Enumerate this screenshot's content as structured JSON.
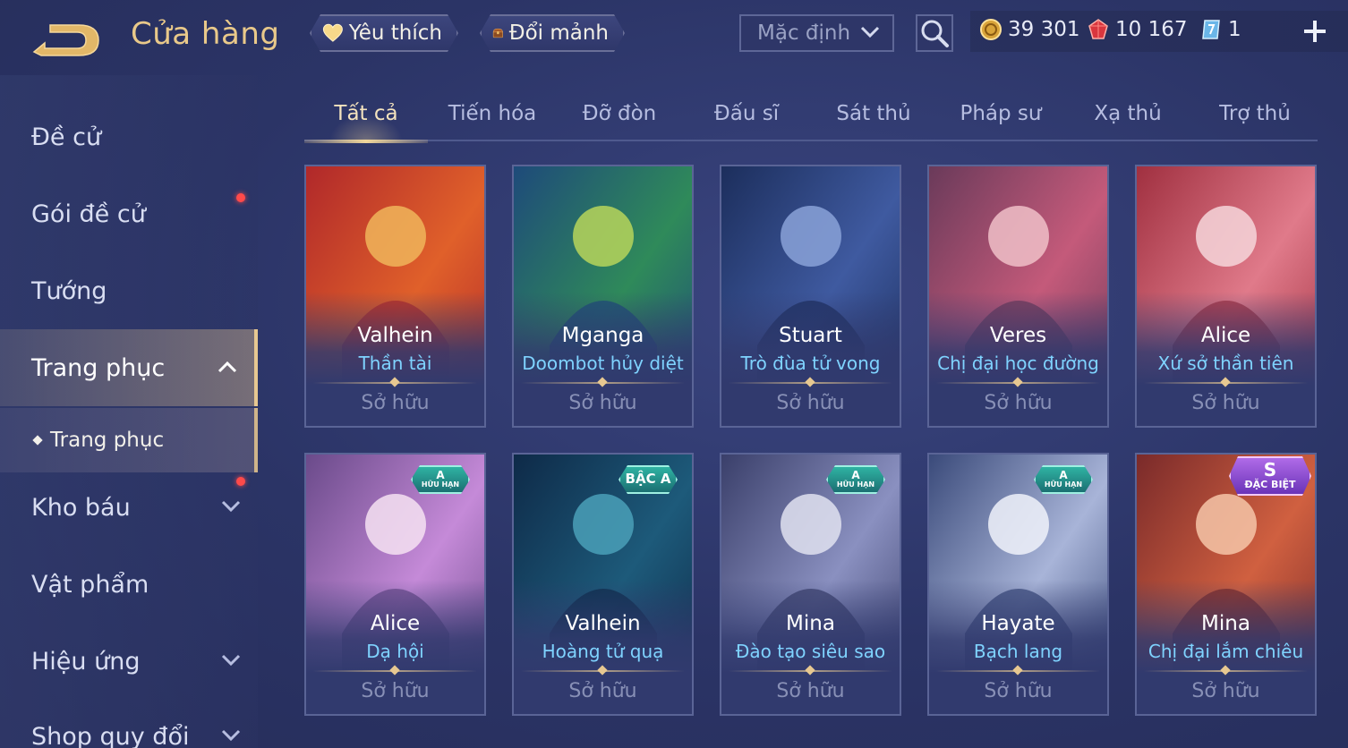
{
  "header": {
    "title": "Cửa hàng",
    "favorites_label": "Yêu thích",
    "exchange_label": "Đổi mảnh",
    "sort_value": "Mặc định"
  },
  "currency": {
    "gold": "39 301",
    "ruby": "10 167",
    "voucher": "1"
  },
  "sidebar": {
    "items": [
      {
        "label": "Đề cử"
      },
      {
        "label": "Gói đề cử"
      },
      {
        "label": "Tướng"
      },
      {
        "label": "Trang phục"
      },
      {
        "label": "Kho báu"
      },
      {
        "label": "Vật phẩm"
      },
      {
        "label": "Hiệu ứng"
      },
      {
        "label": "Shop quy đổi"
      }
    ],
    "sub_item": "Trang phục"
  },
  "tabs": [
    {
      "label": "Tất cả"
    },
    {
      "label": "Tiến hóa"
    },
    {
      "label": "Đỡ đòn"
    },
    {
      "label": "Đấu sĩ"
    },
    {
      "label": "Sát thủ"
    },
    {
      "label": "Pháp sư"
    },
    {
      "label": "Xạ thủ"
    },
    {
      "label": "Trợ thủ"
    }
  ],
  "cards": [
    {
      "hero": "Valhein",
      "skin": "Thần tài",
      "status": "Sở hữu",
      "badge": null
    },
    {
      "hero": "Mganga",
      "skin": "Doombot hủy diệt",
      "status": "Sở hữu",
      "badge": null
    },
    {
      "hero": "Stuart",
      "skin": "Trò đùa tử vong",
      "status": "Sở hữu",
      "badge": null
    },
    {
      "hero": "Veres",
      "skin": "Chị đại học đường",
      "status": "Sở hữu",
      "badge": null
    },
    {
      "hero": "Alice",
      "skin": "Xứ sở thần tiên",
      "status": "Sở hữu",
      "badge": null
    },
    {
      "hero": "Alice",
      "skin": "Dạ hội",
      "status": "Sở hữu",
      "badge": {
        "top": "A",
        "bottom": "HỮU HẠN"
      }
    },
    {
      "hero": "Valhein",
      "skin": "Hoàng tử quạ",
      "status": "Sở hữu",
      "badge": {
        "top": "BẬC A",
        "bottom": ""
      }
    },
    {
      "hero": "Mina",
      "skin": "Đào tạo siêu sao",
      "status": "Sở hữu",
      "badge": {
        "top": "A",
        "bottom": "HỮU HẠN"
      }
    },
    {
      "hero": "Hayate",
      "skin": "Bạch lang",
      "status": "Sở hữu",
      "badge": {
        "top": "A",
        "bottom": "HỮU HẠN"
      }
    },
    {
      "hero": "Mina",
      "skin": "Chị đại lắm chiêu",
      "status": "Sở hữu",
      "badge": {
        "top": "S",
        "bottom": "ĐẶC BIỆT"
      }
    }
  ],
  "colors": {
    "background": "#2c3566",
    "accent_gold": "#e7c891",
    "skin_name": "#7fd3ff",
    "owned_text": "#8890b6",
    "notification_dot": "#ff4a4a"
  },
  "icons": [
    "back-icon",
    "heart-icon",
    "treasure-chest-icon",
    "chevron-down-icon",
    "search-icon",
    "gold-coin-icon",
    "ruby-icon",
    "voucher-icon",
    "plus-icon",
    "chevron-up-icon"
  ]
}
